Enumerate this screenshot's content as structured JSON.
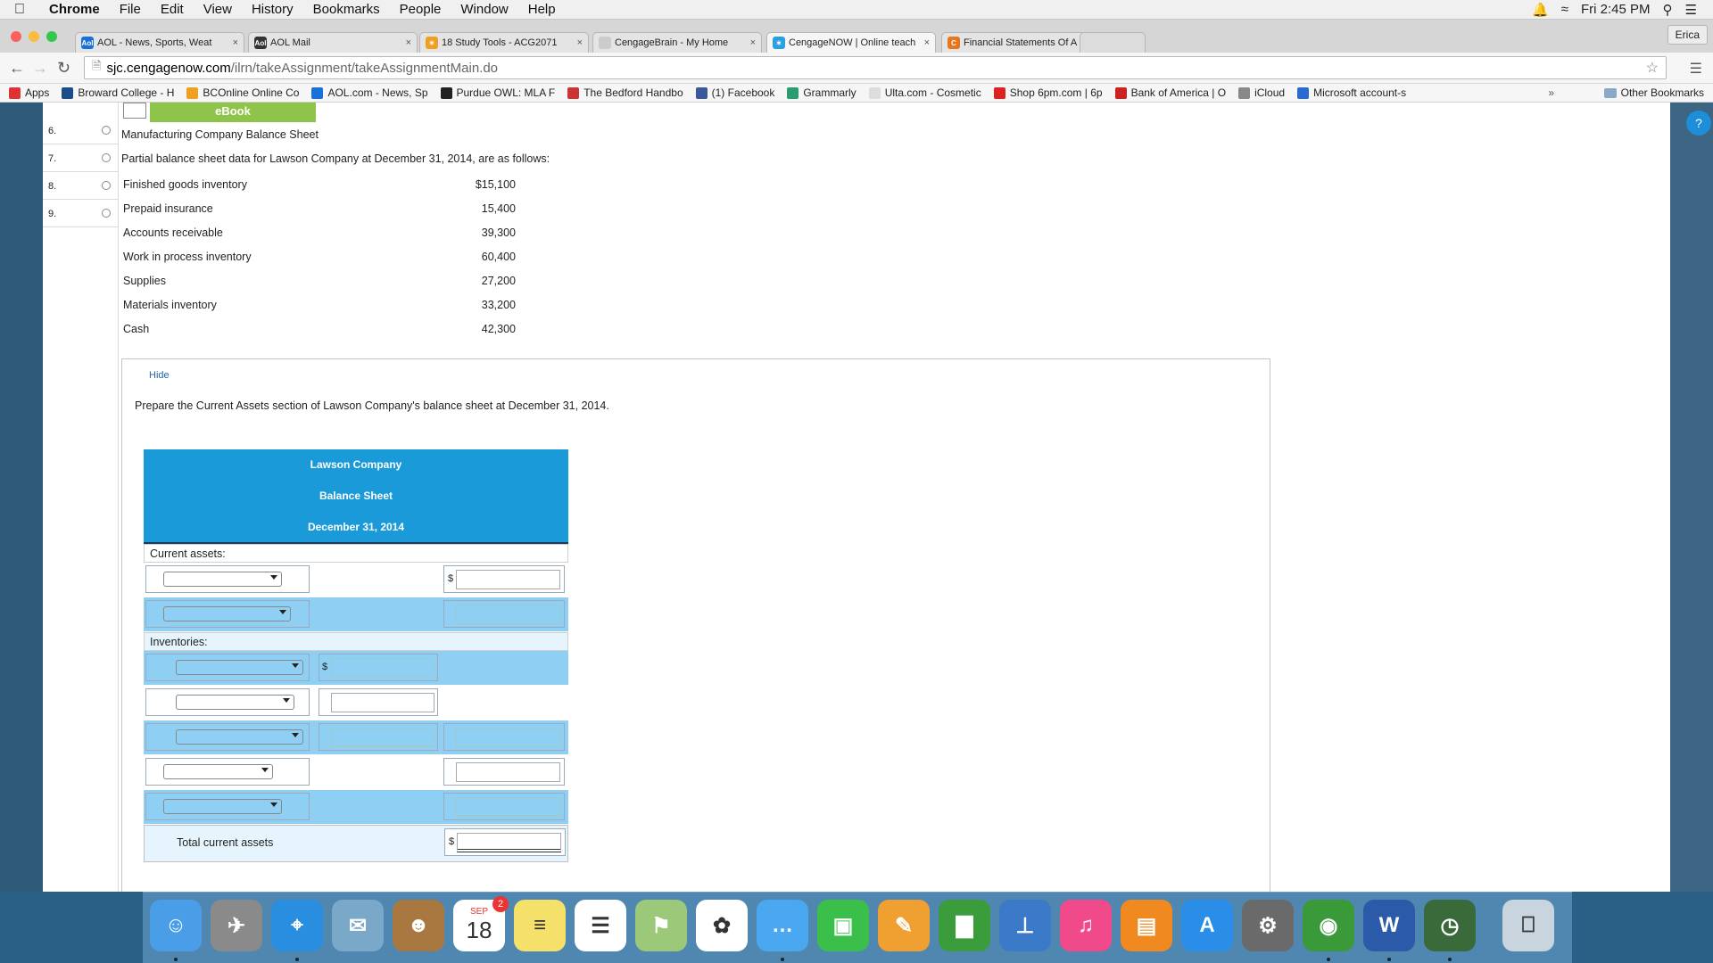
{
  "menubar": {
    "items": [
      "Chrome",
      "File",
      "Edit",
      "View",
      "History",
      "Bookmarks",
      "People",
      "Window",
      "Help"
    ],
    "clock": "Fri 2:45 PM"
  },
  "tabs": [
    {
      "label": "AOL - News, Sports, Weat",
      "color": "#1a6fd8",
      "fav": "Aol"
    },
    {
      "label": "AOL Mail",
      "color": "#333333",
      "fav": "Aol"
    },
    {
      "label": "18 Study Tools - ACG2071",
      "color": "#f0a020",
      "fav": "✶"
    },
    {
      "label": "CengageBrain - My Home",
      "color": "#cccccc",
      "fav": ""
    },
    {
      "label": "CengageNOW | Online teach",
      "color": "#2aa0e0",
      "fav": "✶"
    },
    {
      "label": "Financial Statements Of A M",
      "color": "#e8761c",
      "fav": "C"
    }
  ],
  "profile": "Erica",
  "address": {
    "host": "sjc.cengagenow.com",
    "path": "/ilrn/takeAssignment/takeAssignmentMain.do"
  },
  "bookmarks": [
    {
      "label": "Apps",
      "color": "#d33"
    },
    {
      "label": "Broward College - H",
      "color": "#1a4c8a"
    },
    {
      "label": "BCOnline Online Co",
      "color": "#f0a020"
    },
    {
      "label": "AOL.com - News, Sp",
      "color": "#1a6fd8"
    },
    {
      "label": "Purdue OWL: MLA F",
      "color": "#222"
    },
    {
      "label": "The Bedford Handbo",
      "color": "#c33"
    },
    {
      "label": "(1) Facebook",
      "color": "#3b5998"
    },
    {
      "label": "Grammarly",
      "color": "#2a9d6e"
    },
    {
      "label": "Ulta.com - Cosmetic",
      "color": "#ddd"
    },
    {
      "label": "Shop 6pm.com | 6p",
      "color": "#d22"
    },
    {
      "label": "Bank of America | O",
      "color": "#c22"
    },
    {
      "label": "iCloud",
      "color": "#888"
    },
    {
      "label": "Microsoft account-s",
      "color": "#2a6ad0"
    }
  ],
  "bookmarks_more": "»",
  "bookmarks_other": "Other Bookmarks",
  "questions": [
    "6.",
    "7.",
    "8.",
    "9."
  ],
  "ebook": "eBook",
  "problem": {
    "title": "Manufacturing Company Balance Sheet",
    "intro": "Partial balance sheet data for Lawson Company at December 31, 2014, are as follows:",
    "rows": [
      {
        "label": "Finished goods inventory",
        "value": "$15,100"
      },
      {
        "label": "Prepaid insurance",
        "value": "15,400"
      },
      {
        "label": "Accounts receivable",
        "value": "39,300"
      },
      {
        "label": "Work in process inventory",
        "value": "60,400"
      },
      {
        "label": "Supplies",
        "value": "27,200"
      },
      {
        "label": "Materials inventory",
        "value": "33,200"
      },
      {
        "label": "Cash",
        "value": "42,300"
      }
    ]
  },
  "panel": {
    "hide": "Hide",
    "instruction": "Prepare the Current Assets section of Lawson Company's balance sheet at December 31, 2014."
  },
  "balance_sheet": {
    "company": "Lawson Company",
    "statement": "Balance Sheet",
    "date": "December 31, 2014",
    "current_assets": "Current assets:",
    "inventories": "Inventories:",
    "dollar": "$",
    "total": "Total current assets"
  },
  "dock": [
    {
      "name": "finder-icon",
      "color": "#4a9ee8",
      "glyph": "☺"
    },
    {
      "name": "launchpad-icon",
      "color": "#8a8a8a",
      "glyph": "✈"
    },
    {
      "name": "safari-icon",
      "color": "#2a8ee0",
      "glyph": "⌖"
    },
    {
      "name": "mail-icon",
      "color": "#7aa8c8",
      "glyph": "✉"
    },
    {
      "name": "contacts-icon",
      "color": "#a87840",
      "glyph": "☻"
    },
    {
      "name": "calendar-icon",
      "color": "#ffffff",
      "glyph": "18"
    },
    {
      "name": "notes-icon",
      "color": "#f5e06a",
      "glyph": "≡"
    },
    {
      "name": "reminders-icon",
      "color": "#ffffff",
      "glyph": "☰"
    },
    {
      "name": "maps-icon",
      "color": "#9cc87a",
      "glyph": "⚑"
    },
    {
      "name": "photos-icon",
      "color": "#ffffff",
      "glyph": "✿"
    },
    {
      "name": "messages-icon",
      "color": "#4aa8f0",
      "glyph": "…"
    },
    {
      "name": "facetime-icon",
      "color": "#3ac04a",
      "glyph": "▣"
    },
    {
      "name": "pages-icon",
      "color": "#f0a030",
      "glyph": "✎"
    },
    {
      "name": "numbers-icon",
      "color": "#3a9c3a",
      "glyph": "▇"
    },
    {
      "name": "keynote-icon",
      "color": "#3a7ac8",
      "glyph": "⊥"
    },
    {
      "name": "itunes-icon",
      "color": "#f04a8a",
      "glyph": "♫"
    },
    {
      "name": "ibooks-icon",
      "color": "#f08a20",
      "glyph": "▤"
    },
    {
      "name": "app-store-icon",
      "color": "#2a8ee8",
      "glyph": "A"
    },
    {
      "name": "system-preferences-icon",
      "color": "#6a6a6a",
      "glyph": "⚙"
    },
    {
      "name": "chrome-icon",
      "color": "#3a9a3a",
      "glyph": "◉"
    },
    {
      "name": "word-icon",
      "color": "#2a5aa8",
      "glyph": "W"
    },
    {
      "name": "time-machine-icon",
      "color": "#3a6a3a",
      "glyph": "◷"
    },
    {
      "name": "trash-icon",
      "color": "#c8d4de",
      "glyph": "⎕"
    }
  ],
  "calendar_badge": "2",
  "calendar_month": "SEP"
}
